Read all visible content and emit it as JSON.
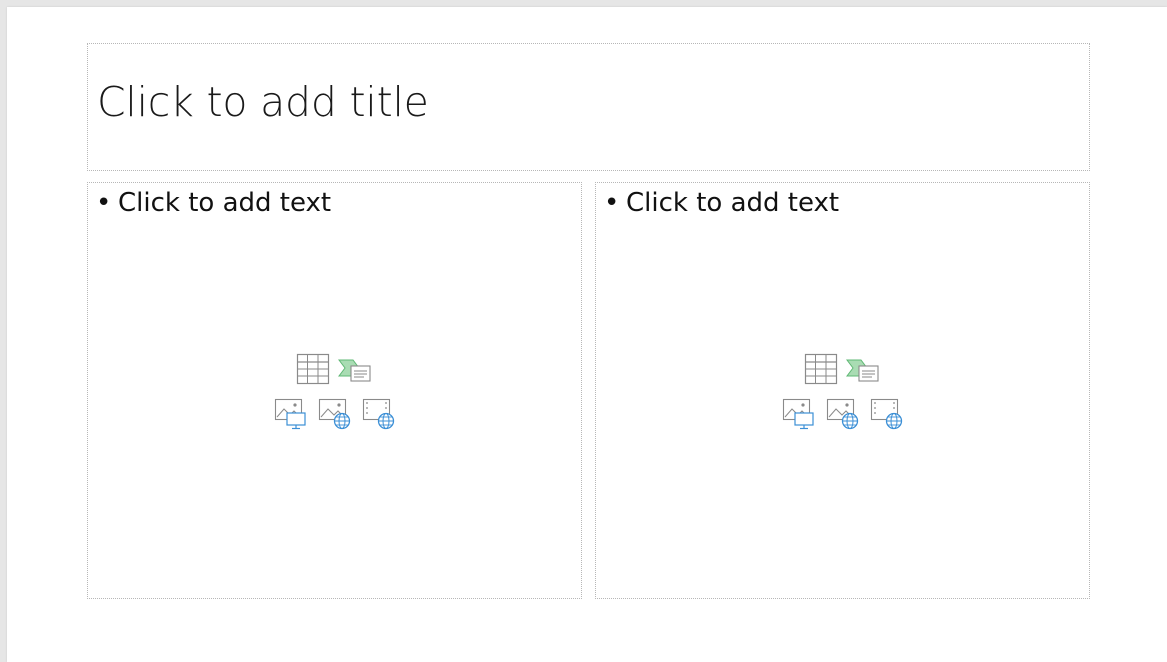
{
  "slide": {
    "title_placeholder": "Click to add title",
    "content_left": {
      "bullet": "•",
      "text": "Click to add text",
      "insert_icons": [
        "insert-table-icon",
        "insert-smartart-icon",
        "insert-picture-icon",
        "insert-online-picture-icon",
        "insert-video-icon"
      ]
    },
    "content_right": {
      "bullet": "•",
      "text": "Click to add text",
      "insert_icons": [
        "insert-table-icon",
        "insert-smartart-icon",
        "insert-picture-icon",
        "insert-online-picture-icon",
        "insert-video-icon"
      ]
    }
  },
  "colors": {
    "placeholder_border": "#b7b7b7",
    "icon_gray": "#8a8a8a",
    "icon_green": "#8fd19e",
    "icon_blue": "#3b8fd6",
    "slide_bg": "#ffffff",
    "canvas_bg": "#e6e6e6"
  }
}
